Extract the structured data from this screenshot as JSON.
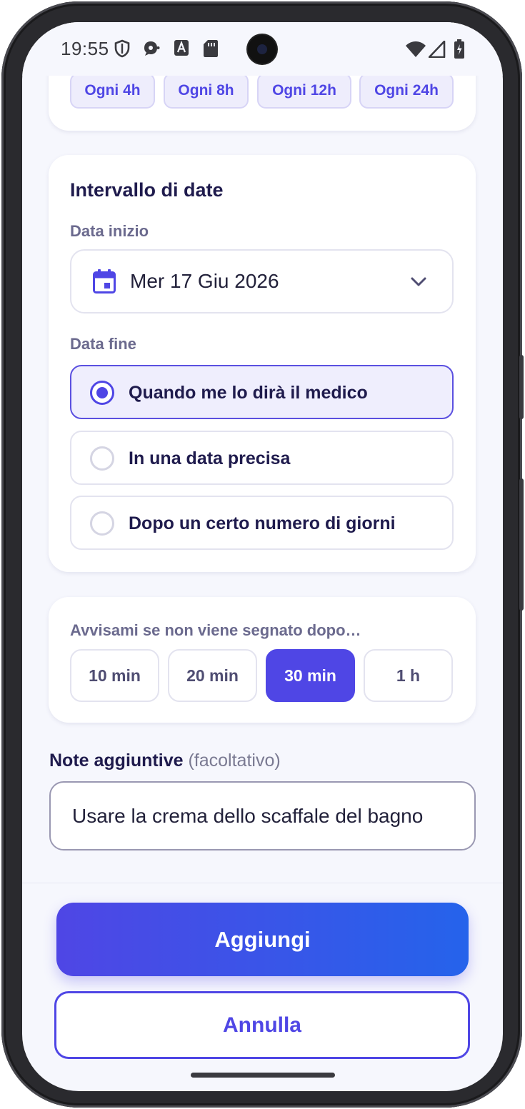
{
  "status_bar": {
    "time": "19:55",
    "left_icons": [
      "shield-icon",
      "messaging-icon",
      "text-a-icon",
      "sd-card-icon"
    ],
    "right_icons": [
      "wifi-icon",
      "signal-icon",
      "battery-charging-icon"
    ]
  },
  "frequency": {
    "chips": [
      "Ogni 4h",
      "Ogni 8h",
      "Ogni 12h",
      "Ogni 24h"
    ]
  },
  "date_range": {
    "title": "Intervallo di date",
    "start_label": "Data inizio",
    "start_value": "Mer 17 Giu 2026",
    "end_label": "Data fine",
    "end_options": [
      {
        "label": "Quando me lo dirà il medico",
        "selected": true
      },
      {
        "label": "In una data precisa",
        "selected": false
      },
      {
        "label": "Dopo un certo numero di giorni",
        "selected": false
      }
    ]
  },
  "reminder": {
    "label": "Avvisami se non viene segnato dopo…",
    "options": [
      "10 min",
      "20 min",
      "30 min",
      "1 h"
    ],
    "selected": "30 min"
  },
  "notes": {
    "label": "Note aggiuntive",
    "optional": "(facoltativo)",
    "value": "Usare la crema dello scaffale del bagno"
  },
  "actions": {
    "add_label": "Aggiungi",
    "cancel_label": "Annulla"
  },
  "colors": {
    "accent": "#4f46e5",
    "accent_gradient_end": "#2563eb",
    "background": "#f6f7fd",
    "heading": "#1f1b4d"
  }
}
